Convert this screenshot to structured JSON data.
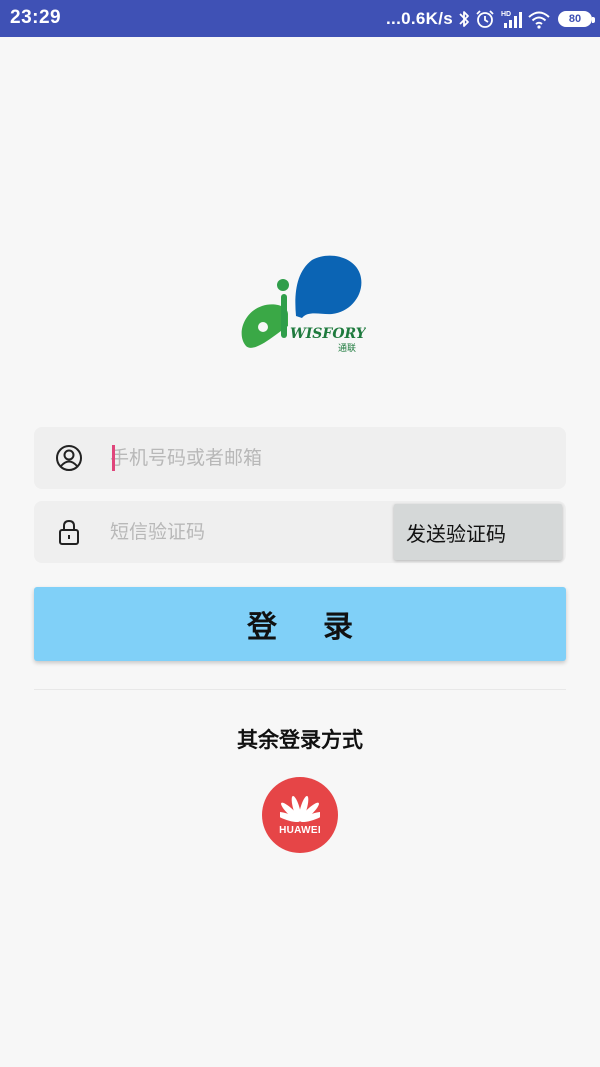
{
  "status_bar": {
    "time": "23:29",
    "net_speed": "...0.6K/s",
    "hd_label": "HD",
    "battery": "80"
  },
  "logo": {
    "brand": "WISFORY",
    "sub": "通联"
  },
  "form": {
    "phone_placeholder": "手机号码或者邮箱",
    "code_placeholder": "短信验证码",
    "send_code_label": "发送验证码",
    "login_label": "登录"
  },
  "other_login": {
    "label": "其余登录方式",
    "huawei_label": "HUAWEI"
  },
  "colors": {
    "status_bar": "#3f51b5",
    "login_button": "#80d0f8",
    "huawei": "#e64547",
    "logo_green": "#3aa846",
    "logo_blue": "#0b64b4"
  }
}
